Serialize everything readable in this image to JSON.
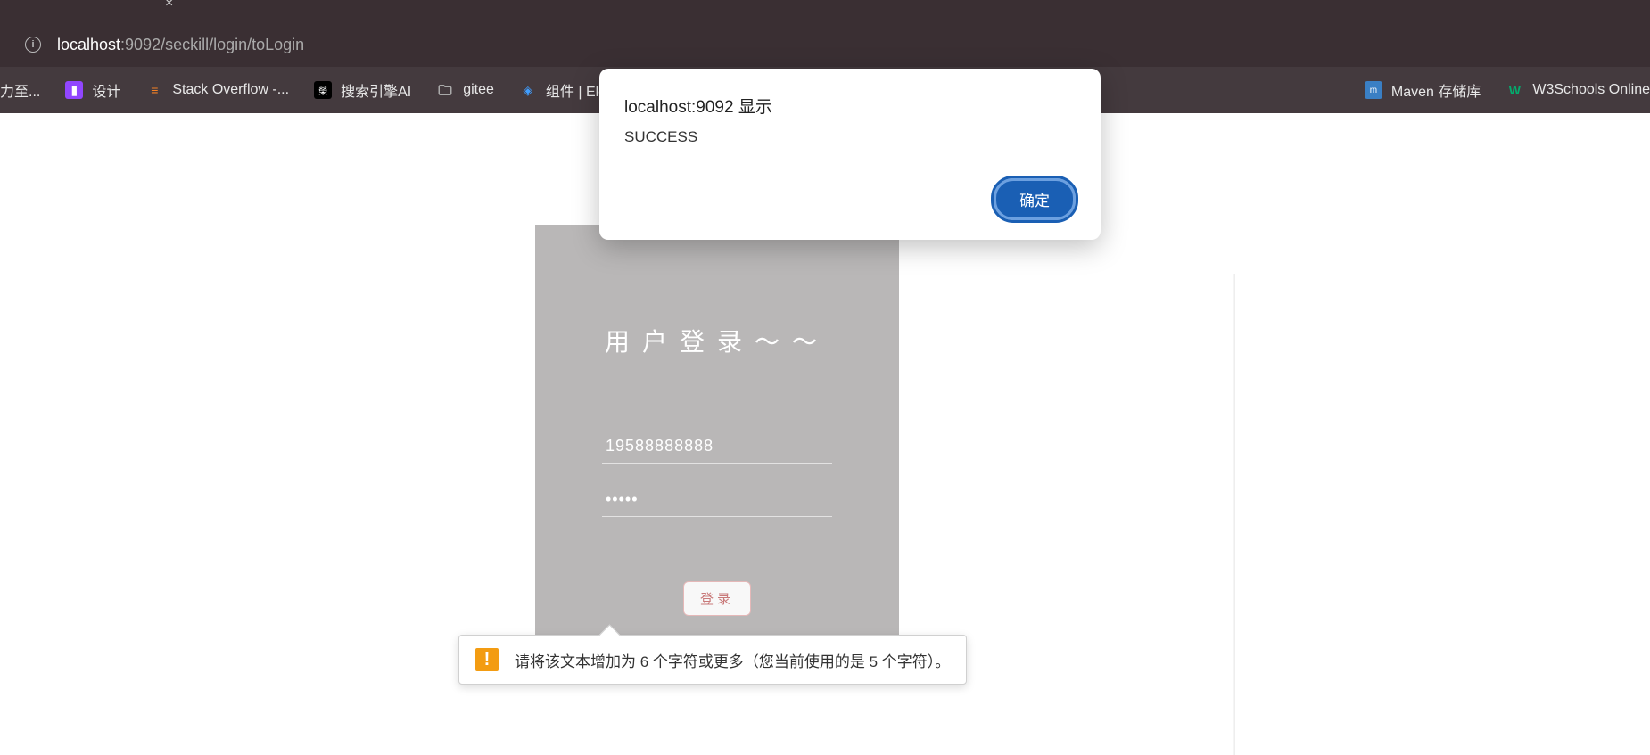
{
  "browser": {
    "url_host": "localhost",
    "url_rest": ":9092/seckill/login/toLogin"
  },
  "bookmarks": [
    {
      "label": "力至...",
      "icon": ""
    },
    {
      "label": "设计",
      "icon": "twitch"
    },
    {
      "label": "Stack Overflow -...",
      "icon": "stack"
    },
    {
      "label": "搜索引擎AI",
      "icon": "search"
    },
    {
      "label": "gitee",
      "icon": "folder"
    },
    {
      "label": "组件 | Elen",
      "icon": "element"
    },
    {
      "label": "Maven 存储库",
      "icon": "maven"
    },
    {
      "label": "W3Schools Online",
      "icon": "w3"
    }
  ],
  "alert": {
    "title": "localhost:9092 显示",
    "message": "SUCCESS",
    "ok_label": "确定"
  },
  "login": {
    "title": "用户登录～～",
    "username_value": "19588888888",
    "password_value": "•••••",
    "submit_label": "登录"
  },
  "validation": {
    "message": "请将该文本增加为 6 个字符或更多（您当前使用的是 5 个字符）。"
  }
}
